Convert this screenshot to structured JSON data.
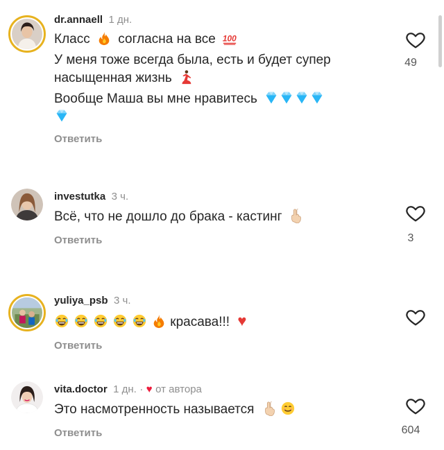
{
  "reply_label": "Ответить",
  "comments": [
    {
      "username": "dr.annaell",
      "time": "1 дн.",
      "lines": [
        "Класс",
        "согласна на все",
        "У меня тоже всегда была, есть и будет супер",
        "насыщенная жизнь",
        "Вообще Маша вы мне нравитесь"
      ],
      "likes": "49"
    },
    {
      "username": "investutka",
      "time": "3 ч.",
      "lines": [
        "Всё, что не дошло до брака - кастинг"
      ],
      "likes": "3"
    },
    {
      "username": "yuliya_psb",
      "time": "3 ч.",
      "lines": [
        "красава!!!"
      ],
      "likes": ""
    },
    {
      "username": "vita.doctor",
      "time": "1 дн.",
      "separator": "·",
      "author_badge": "от автора",
      "lines": [
        "Это насмотренность называется"
      ],
      "likes": "604"
    }
  ],
  "colors": {
    "accent_heart": "#ed1c3c",
    "secondary_text": "#8e8e8e",
    "story_ring": "#e7b21f"
  }
}
